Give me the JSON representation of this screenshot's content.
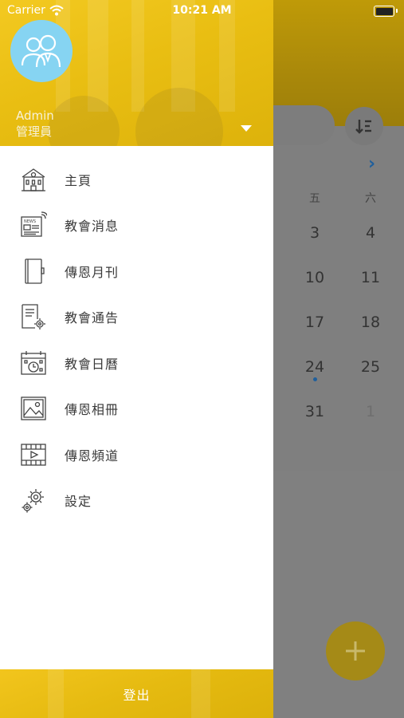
{
  "status_bar": {
    "carrier": "Carrier",
    "time": "10:21 AM"
  },
  "drawer": {
    "user": {
      "name": "Admin",
      "role": "管理員"
    },
    "menu": [
      {
        "label": "主頁",
        "icon": "church-building-icon"
      },
      {
        "label": "教會消息",
        "icon": "newspaper-icon"
      },
      {
        "label": "傳恩月刊",
        "icon": "magazine-book-icon"
      },
      {
        "label": "教會通告",
        "icon": "notice-document-gear-icon"
      },
      {
        "label": "教會日曆",
        "icon": "calendar-clock-icon"
      },
      {
        "label": "傳恩相冊",
        "icon": "photo-album-icon"
      },
      {
        "label": "傳恩頻道",
        "icon": "video-channel-icon"
      },
      {
        "label": "設定",
        "icon": "settings-gear-icon"
      }
    ],
    "logout_label": "登出"
  },
  "background_calendar": {
    "weekday_headers": [
      "五",
      "六"
    ],
    "rows": [
      [
        "3",
        "4"
      ],
      [
        "10",
        "11"
      ],
      [
        "17",
        "18"
      ],
      [
        "24",
        "25"
      ],
      [
        "31",
        "1"
      ]
    ],
    "event_marker_day": "24"
  },
  "colors": {
    "drawer_header": "#E9BE12",
    "avatar_bg": "#86D4F2",
    "accent_blue": "#1F5F9C"
  }
}
